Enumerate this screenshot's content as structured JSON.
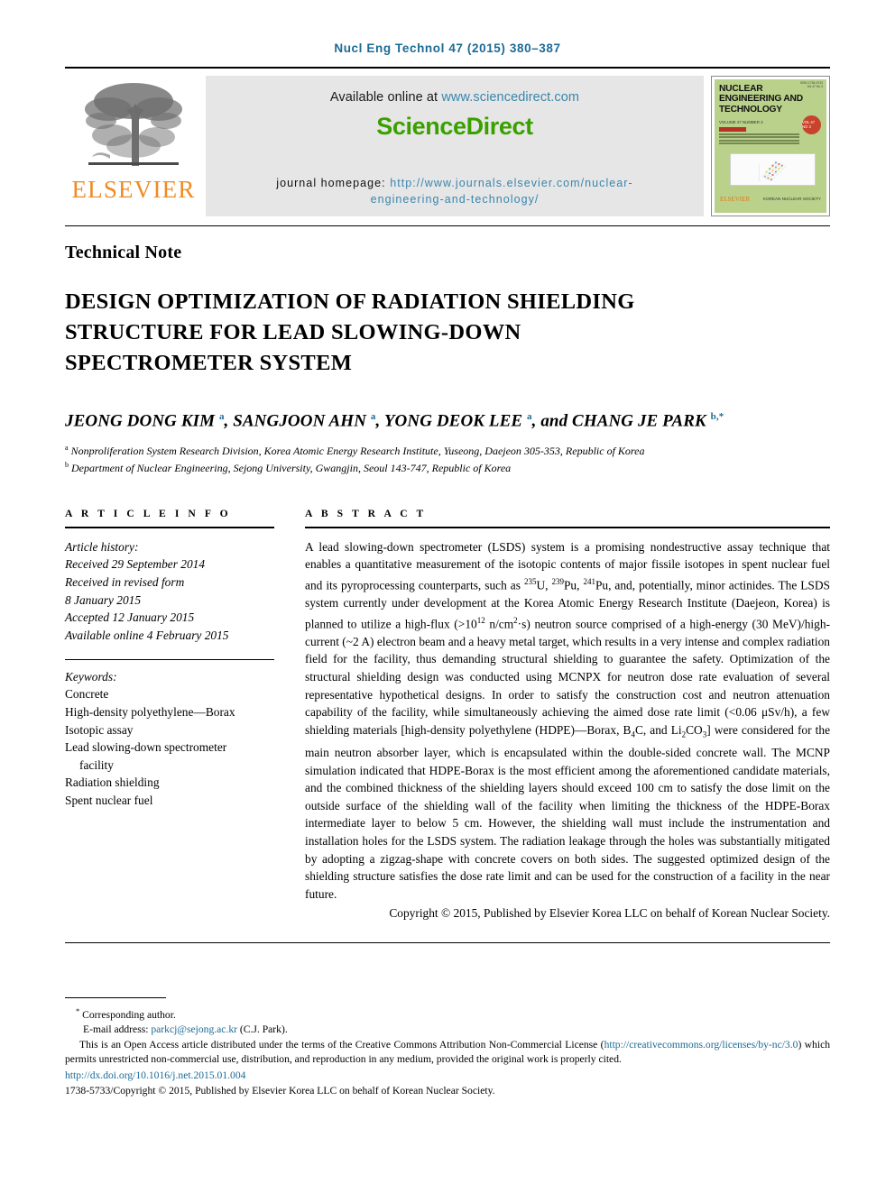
{
  "running_head": "Nucl Eng Technol 47 (2015) 380–387",
  "masthead": {
    "publisher_wordmark": "ELSEVIER",
    "available_label": "Available online at ",
    "available_link": "www.sciencedirect.com",
    "sciencedirect_logo": "ScienceDirect",
    "homepage_label": "journal homepage: ",
    "homepage_link_line1": "http://www.journals.elsevier.com/nuclear-",
    "homepage_link_line2": "engineering-and-technology/",
    "cover": {
      "title_line1": "NUCLEAR",
      "title_line2": "ENGINEERING AND",
      "title_line3": "TECHNOLOGY",
      "volume_line": "VOLUME 47  NUMBER 3",
      "issue_corner": "ISSN 1738-5733\nVol.47 No.3",
      "badge": "VOL 47\nNO 3",
      "publisher_mark": "ELSEVIER",
      "society_mark": "KOREAN NUCLEAR SOCIETY"
    }
  },
  "article": {
    "type": "Technical Note",
    "title": "DESIGN OPTIMIZATION OF RADIATION SHIELDING STRUCTURE FOR LEAD SLOWING-DOWN SPECTROMETER SYSTEM",
    "authors_html": "JEONG DONG KIM <sup>a</sup>, SANGJOON AHN <sup>a</sup>, YONG DEOK LEE <sup>a</sup>, and CHANG JE PARK <sup>b,*</sup>",
    "affiliations": [
      {
        "marker": "a",
        "text": "Nonproliferation System Research Division, Korea Atomic Energy Research Institute, Yuseong, Daejeon 305-353, Republic of Korea"
      },
      {
        "marker": "b",
        "text": "Department of Nuclear Engineering, Sejong University, Gwangjin, Seoul 143-747, Republic of Korea"
      }
    ]
  },
  "article_info": {
    "heading": "A R T I C L E   I N F O",
    "history_label": "Article history:",
    "history": [
      "Received 29 September 2014",
      "Received in revised form",
      "8 January 2015",
      "Accepted 12 January 2015",
      "Available online 4 February 2015"
    ],
    "keywords_label": "Keywords:",
    "keywords": [
      "Concrete",
      "High-density polyethylene—Borax",
      "Isotopic assay",
      "Lead slowing-down spectrometer",
      "facility",
      "Radiation shielding",
      "Spent nuclear fuel"
    ]
  },
  "abstract": {
    "heading": "A B S T R A C T",
    "body_html": "A lead slowing-down spectrometer (LSDS) system is a promising nondestructive assay technique that enables a quantitative measurement of the isotopic contents of major fissile isotopes in spent nuclear fuel and its pyroprocessing counterparts, such as <sup>235</sup>U, <sup>239</sup>Pu, <sup>241</sup>Pu, and, potentially, minor actinides. The LSDS system currently under development at the Korea Atomic Energy Research Institute (Daejeon, Korea) is planned to utilize a high-flux (&gt;10<sup>12</sup> n/cm<sup>2</sup>·s) neutron source comprised of a high-energy (30 MeV)/high-current (~2 A) electron beam and a heavy metal target, which results in a very intense and complex radiation field for the facility, thus demanding structural shielding to guarantee the safety. Optimization of the structural shielding design was conducted using MCNPX for neutron dose rate evaluation of several representative hypothetical designs. In order to satisfy the construction cost and neutron attenuation capability of the facility, while simultaneously achieving the aimed dose rate limit (&lt;0.06 μSv/h), a few shielding materials [high-density polyethylene (HDPE)—Borax, B<sub>4</sub>C, and Li<sub>2</sub>CO<sub>3</sub>] were considered for the main neutron absorber layer, which is encapsulated within the double-sided concrete wall. The MCNP simulation indicated that HDPE-Borax is the most efficient among the aforementioned candidate materials, and the combined thickness of the shielding layers should exceed 100 cm to satisfy the dose limit on the outside surface of the shielding wall of the facility when limiting the thickness of the HDPE-Borax intermediate layer to below 5 cm. However, the shielding wall must include the instrumentation and installation holes for the LSDS system. The radiation leakage through the holes was substantially mitigated by adopting a zigzag-shape with concrete covers on both sides. The suggested optimized design of the shielding structure satisfies the dose rate limit and can be used for the construction of a facility in the near future.",
    "copyright": "Copyright © 2015, Published by Elsevier Korea LLC on behalf of Korean Nuclear Society."
  },
  "footnotes": {
    "corresponding": "Corresponding author.",
    "email_label": "E-mail address: ",
    "email_link": "parkcj@sejong.ac.kr",
    "email_suffix": " (C.J. Park).",
    "license_pre": "This is an Open Access article distributed under the terms of the Creative Commons Attribution Non-Commercial License (",
    "license_link": "http://creativecommons.org/licenses/by-nc/3.0",
    "license_post": ") which permits unrestricted non-commercial use, distribution, and reproduction in any medium, provided the original work is properly cited.",
    "doi": "http://dx.doi.org/10.1016/j.net.2015.01.004",
    "issn_line": "1738-5733/Copyright © 2015, Published by Elsevier Korea LLC on behalf of Korean Nuclear Society."
  },
  "colors": {
    "link_blue": "#1b6a95",
    "sciencedirect_green": "#3aa000",
    "elsevier_orange": "#f08a24",
    "masthead_gray": "#e6e6e6",
    "cover_green": "#b9d18b"
  }
}
